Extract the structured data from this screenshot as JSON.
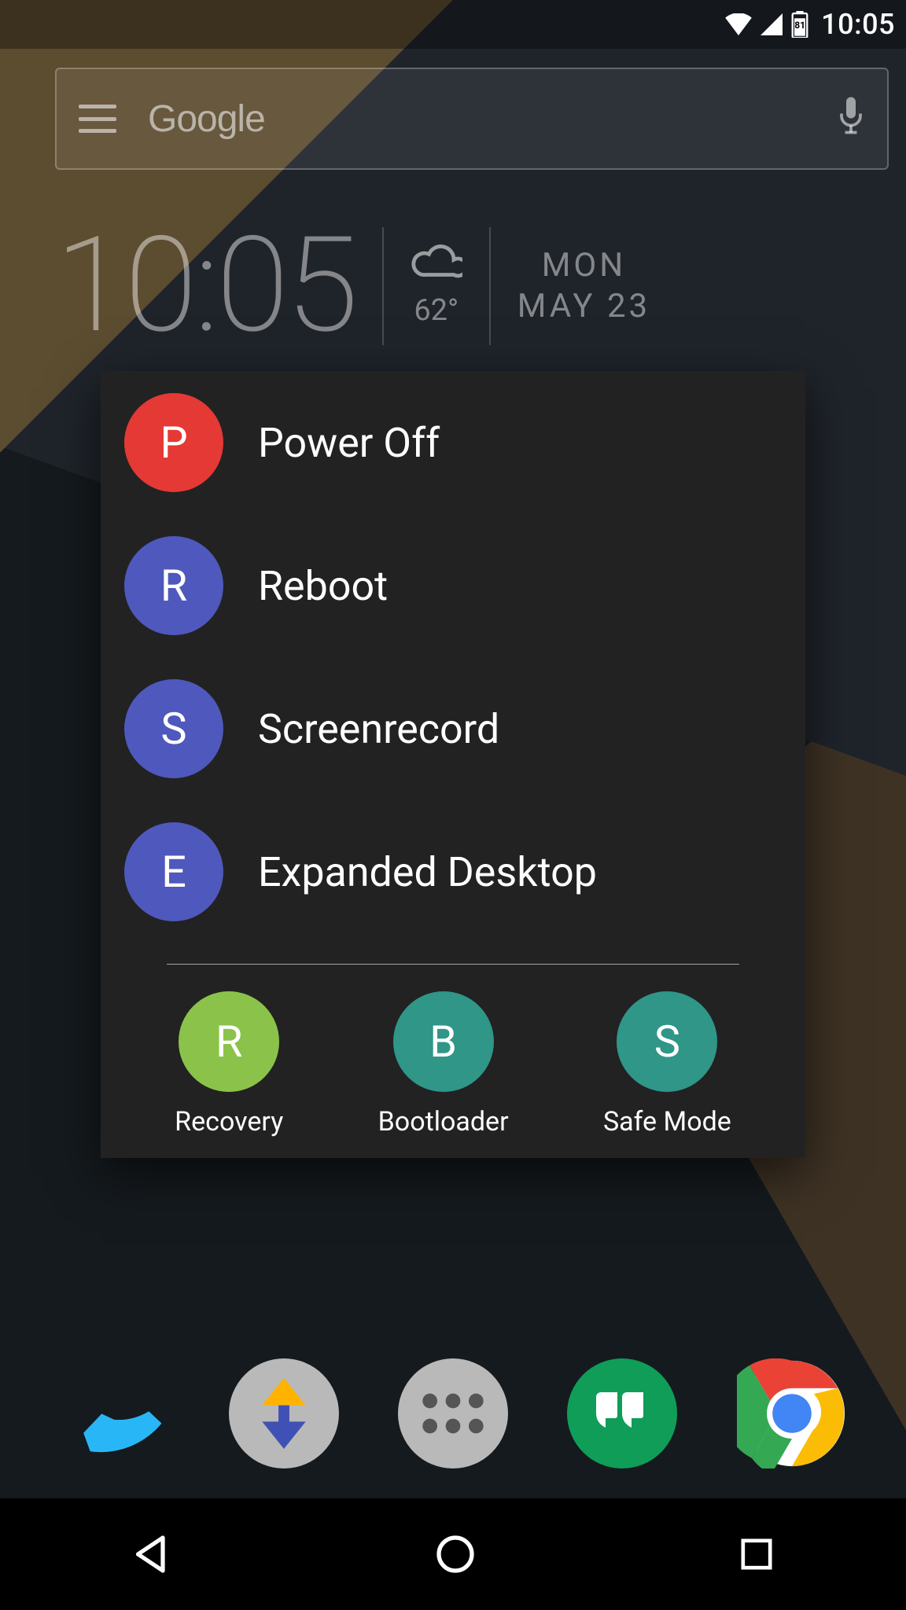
{
  "status_bar": {
    "battery_pct": "81",
    "time": "10:05"
  },
  "search": {
    "logo_text": "Google"
  },
  "clock_widget": {
    "time": "10:05",
    "temperature": "62°",
    "date_day": "MON",
    "date_md": "MAY 23"
  },
  "power_menu": {
    "items": [
      {
        "short": "P",
        "label": "Power Off",
        "color": "red"
      },
      {
        "short": "R",
        "label": "Reboot",
        "color": "blue"
      },
      {
        "short": "S",
        "label": "Screenrecord",
        "color": "blue"
      },
      {
        "short": "E",
        "label": "Expanded Desktop",
        "color": "blue"
      }
    ],
    "bottom_items": [
      {
        "short": "R",
        "label": "Recovery",
        "color": "green"
      },
      {
        "short": "B",
        "label": "Bootloader",
        "color": "teal"
      },
      {
        "short": "S",
        "label": "Safe Mode",
        "color": "teal"
      }
    ]
  }
}
